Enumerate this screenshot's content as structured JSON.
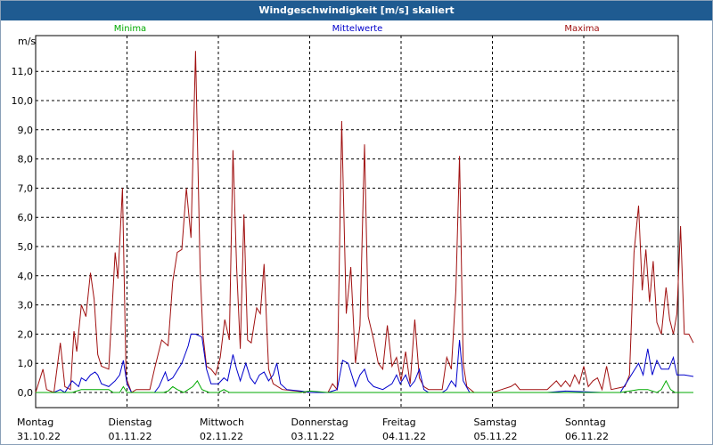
{
  "window": {
    "title": "Windgeschwindigkeit [m/s] skaliert"
  },
  "colors": {
    "min": "#00aa00",
    "mean": "#0000cc",
    "max": "#a01010",
    "titlebar": "#1f5b91"
  },
  "chart_data": {
    "type": "line",
    "title": "Windgeschwindigkeit [m/s] skaliert",
    "ylabel": "m/s",
    "xlabel": "",
    "ylim": [
      -0.2,
      12.5
    ],
    "xlim": [
      0,
      7.25
    ],
    "grid": true,
    "legend_placement": "top",
    "yticks": [
      "0,0",
      "1,0",
      "2,0",
      "3,0",
      "4,0",
      "5,0",
      "6,0",
      "7,0",
      "8,0",
      "9,0",
      "10,0",
      "11,0"
    ],
    "x_ticks": [
      {
        "day": "Montag",
        "date": "31.10.22"
      },
      {
        "day": "Dienstag",
        "date": "01.11.22"
      },
      {
        "day": "Mittwoch",
        "date": "02.11.22"
      },
      {
        "day": "Donnerstag",
        "date": "03.11.22"
      },
      {
        "day": "Freitag",
        "date": "04.11.22"
      },
      {
        "day": "Samstag",
        "date": "05.11.22"
      },
      {
        "day": "Sonntag",
        "date": "06.11.22"
      }
    ],
    "series": [
      {
        "name": "Minima",
        "points": [
          [
            0,
            0
          ],
          [
            0.4,
            0
          ],
          [
            0.45,
            0.05
          ],
          [
            0.5,
            0.1
          ],
          [
            0.8,
            0.1
          ],
          [
            0.85,
            0
          ],
          [
            0.92,
            0
          ],
          [
            0.96,
            0.2
          ],
          [
            1.0,
            0
          ],
          [
            1.4,
            0
          ],
          [
            1.45,
            0.05
          ],
          [
            1.5,
            0.2
          ],
          [
            1.55,
            0.1
          ],
          [
            1.62,
            0
          ],
          [
            1.72,
            0.2
          ],
          [
            1.77,
            0.4
          ],
          [
            1.82,
            0.1
          ],
          [
            1.9,
            0
          ],
          [
            2.0,
            0
          ],
          [
            2.06,
            0.1
          ],
          [
            2.12,
            0
          ],
          [
            2.9,
            0
          ],
          [
            3.0,
            0.05
          ],
          [
            3.2,
            0
          ],
          [
            4.6,
            0
          ],
          [
            5.6,
            0
          ],
          [
            6.2,
            0
          ],
          [
            6.4,
            0
          ],
          [
            6.6,
            0.1
          ],
          [
            6.7,
            0.1
          ],
          [
            6.8,
            0
          ],
          [
            6.85,
            0.1
          ],
          [
            6.9,
            0.4
          ],
          [
            6.95,
            0.1
          ],
          [
            7.0,
            0
          ],
          [
            7.2,
            0
          ]
        ]
      },
      {
        "name": "Mittelwerte",
        "points": [
          [
            0,
            0
          ],
          [
            0.2,
            0
          ],
          [
            0.27,
            0.1
          ],
          [
            0.32,
            0
          ],
          [
            0.4,
            0.4
          ],
          [
            0.47,
            0.2
          ],
          [
            0.5,
            0.5
          ],
          [
            0.55,
            0.4
          ],
          [
            0.6,
            0.6
          ],
          [
            0.65,
            0.7
          ],
          [
            0.68,
            0.6
          ],
          [
            0.72,
            0.3
          ],
          [
            0.8,
            0.2
          ],
          [
            0.87,
            0.4
          ],
          [
            0.92,
            0.6
          ],
          [
            0.96,
            1.1
          ],
          [
            1.0,
            0.3
          ],
          [
            1.05,
            0
          ],
          [
            1.3,
            0
          ],
          [
            1.35,
            0.2
          ],
          [
            1.42,
            0.7
          ],
          [
            1.45,
            0.4
          ],
          [
            1.5,
            0.5
          ],
          [
            1.6,
            1.0
          ],
          [
            1.67,
            1.6
          ],
          [
            1.7,
            2.0
          ],
          [
            1.75,
            2.0
          ],
          [
            1.82,
            1.9
          ],
          [
            1.87,
            0.8
          ],
          [
            1.92,
            0.3
          ],
          [
            2.0,
            0.3
          ],
          [
            2.06,
            0.5
          ],
          [
            2.1,
            0.4
          ],
          [
            2.16,
            1.3
          ],
          [
            2.2,
            0.8
          ],
          [
            2.24,
            0.4
          ],
          [
            2.3,
            1.0
          ],
          [
            2.35,
            0.5
          ],
          [
            2.4,
            0.3
          ],
          [
            2.45,
            0.6
          ],
          [
            2.5,
            0.7
          ],
          [
            2.55,
            0.4
          ],
          [
            2.6,
            0.6
          ],
          [
            2.64,
            1.0
          ],
          [
            2.68,
            0.3
          ],
          [
            2.75,
            0.1
          ],
          [
            2.9,
            0.05
          ],
          [
            3.0,
            0
          ],
          [
            3.2,
            0
          ],
          [
            3.3,
            0.1
          ],
          [
            3.36,
            1.1
          ],
          [
            3.42,
            1.0
          ],
          [
            3.5,
            0.2
          ],
          [
            3.55,
            0.6
          ],
          [
            3.6,
            0.8
          ],
          [
            3.64,
            0.4
          ],
          [
            3.7,
            0.2
          ],
          [
            3.8,
            0.1
          ],
          [
            3.9,
            0.3
          ],
          [
            3.95,
            0.6
          ],
          [
            3.99,
            0.3
          ],
          [
            4.05,
            0.6
          ],
          [
            4.1,
            0.2
          ],
          [
            4.15,
            0.4
          ],
          [
            4.2,
            0.8
          ],
          [
            4.25,
            0.1
          ],
          [
            4.3,
            0
          ],
          [
            4.45,
            0
          ],
          [
            4.5,
            0.1
          ],
          [
            4.55,
            0.4
          ],
          [
            4.6,
            0.2
          ],
          [
            4.64,
            1.8
          ],
          [
            4.68,
            0.4
          ],
          [
            4.75,
            0
          ],
          [
            5.6,
            0
          ],
          [
            5.8,
            0.05
          ],
          [
            6.2,
            0
          ],
          [
            6.4,
            0
          ],
          [
            6.6,
            1.0
          ],
          [
            6.65,
            0.6
          ],
          [
            6.7,
            1.5
          ],
          [
            6.75,
            0.6
          ],
          [
            6.8,
            1.1
          ],
          [
            6.85,
            0.8
          ],
          [
            6.9,
            0.8
          ],
          [
            6.93,
            0.8
          ],
          [
            6.98,
            1.2
          ],
          [
            7.02,
            0.6
          ],
          [
            7.1,
            0.6
          ],
          [
            7.2,
            0.55
          ]
        ]
      },
      {
        "name": "Maxima",
        "points": [
          [
            0,
            0
          ],
          [
            0.08,
            0.8
          ],
          [
            0.12,
            0.1
          ],
          [
            0.2,
            0
          ],
          [
            0.27,
            1.7
          ],
          [
            0.32,
            0.2
          ],
          [
            0.38,
            0.1
          ],
          [
            0.42,
            2.1
          ],
          [
            0.45,
            1.4
          ],
          [
            0.5,
            3.0
          ],
          [
            0.55,
            2.6
          ],
          [
            0.6,
            4.1
          ],
          [
            0.64,
            3.2
          ],
          [
            0.68,
            1.3
          ],
          [
            0.72,
            0.9
          ],
          [
            0.8,
            0.8
          ],
          [
            0.87,
            4.8
          ],
          [
            0.9,
            3.9
          ],
          [
            0.95,
            7.0
          ],
          [
            0.99,
            0.5
          ],
          [
            1.05,
            0
          ],
          [
            1.1,
            0.1
          ],
          [
            1.25,
            0.1
          ],
          [
            1.3,
            0.8
          ],
          [
            1.38,
            1.8
          ],
          [
            1.45,
            1.6
          ],
          [
            1.5,
            3.8
          ],
          [
            1.55,
            4.8
          ],
          [
            1.6,
            4.9
          ],
          [
            1.65,
            7.0
          ],
          [
            1.7,
            5.3
          ],
          [
            1.75,
            11.7
          ],
          [
            1.8,
            4.3
          ],
          [
            1.83,
            2.0
          ],
          [
            1.87,
            0.9
          ],
          [
            1.92,
            0.8
          ],
          [
            1.97,
            0.6
          ],
          [
            2.02,
            1.2
          ],
          [
            2.07,
            2.5
          ],
          [
            2.12,
            1.8
          ],
          [
            2.16,
            8.3
          ],
          [
            2.2,
            4.3
          ],
          [
            2.24,
            1.5
          ],
          [
            2.28,
            6.1
          ],
          [
            2.32,
            1.8
          ],
          [
            2.36,
            1.7
          ],
          [
            2.42,
            2.9
          ],
          [
            2.46,
            2.7
          ],
          [
            2.5,
            4.4
          ],
          [
            2.55,
            0.8
          ],
          [
            2.6,
            0.3
          ],
          [
            2.7,
            0.1
          ],
          [
            3.0,
            0
          ],
          [
            3.2,
            0
          ],
          [
            3.25,
            0.3
          ],
          [
            3.3,
            0.1
          ],
          [
            3.35,
            9.3
          ],
          [
            3.4,
            2.7
          ],
          [
            3.45,
            4.3
          ],
          [
            3.5,
            1.0
          ],
          [
            3.55,
            2.3
          ],
          [
            3.6,
            8.5
          ],
          [
            3.64,
            2.6
          ],
          [
            3.7,
            1.8
          ],
          [
            3.75,
            1.0
          ],
          [
            3.8,
            0.8
          ],
          [
            3.85,
            2.3
          ],
          [
            3.9,
            0.9
          ],
          [
            3.95,
            1.2
          ],
          [
            4.0,
            0.4
          ],
          [
            4.05,
            1.4
          ],
          [
            4.1,
            0.3
          ],
          [
            4.15,
            2.5
          ],
          [
            4.2,
            0.5
          ],
          [
            4.25,
            0.2
          ],
          [
            4.3,
            0.1
          ],
          [
            4.45,
            0.1
          ],
          [
            4.5,
            1.2
          ],
          [
            4.55,
            0.8
          ],
          [
            4.6,
            3.5
          ],
          [
            4.64,
            8.1
          ],
          [
            4.68,
            1.0
          ],
          [
            4.72,
            0.2
          ],
          [
            4.8,
            0
          ],
          [
            5.0,
            0
          ],
          [
            5.1,
            0.1
          ],
          [
            5.2,
            0.2
          ],
          [
            5.25,
            0.3
          ],
          [
            5.3,
            0.1
          ],
          [
            5.6,
            0.1
          ],
          [
            5.7,
            0.4
          ],
          [
            5.75,
            0.2
          ],
          [
            5.8,
            0.4
          ],
          [
            5.85,
            0.2
          ],
          [
            5.9,
            0.6
          ],
          [
            5.95,
            0.3
          ],
          [
            6.0,
            0.9
          ],
          [
            6.05,
            0.2
          ],
          [
            6.1,
            0.4
          ],
          [
            6.15,
            0.5
          ],
          [
            6.2,
            0.1
          ],
          [
            6.25,
            0.9
          ],
          [
            6.3,
            0.1
          ],
          [
            6.45,
            0.2
          ],
          [
            6.5,
            0.6
          ],
          [
            6.55,
            4.8
          ],
          [
            6.6,
            6.4
          ],
          [
            6.64,
            3.5
          ],
          [
            6.68,
            4.9
          ],
          [
            6.72,
            3.1
          ],
          [
            6.76,
            4.5
          ],
          [
            6.8,
            2.4
          ],
          [
            6.85,
            2.0
          ],
          [
            6.9,
            3.6
          ],
          [
            6.94,
            2.5
          ],
          [
            6.98,
            2.0
          ],
          [
            7.02,
            2.7
          ],
          [
            7.06,
            5.7
          ],
          [
            7.1,
            2.0
          ],
          [
            7.15,
            2.0
          ],
          [
            7.2,
            1.7
          ]
        ]
      }
    ]
  }
}
